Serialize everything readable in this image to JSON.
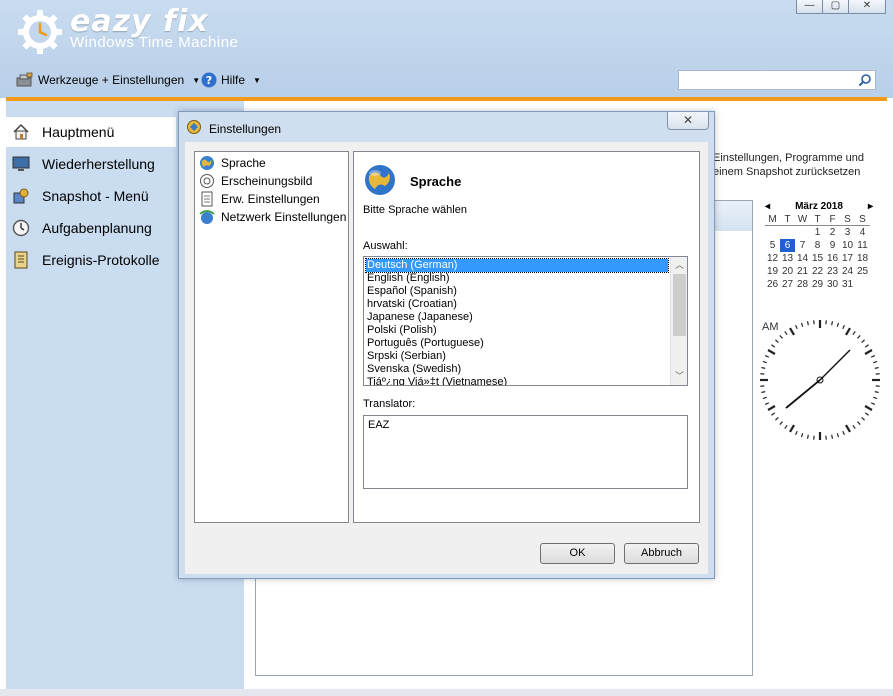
{
  "app": {
    "logo_title": "eazy fix",
    "logo_subtitle": "Windows Time Machine"
  },
  "window_controls": {
    "minimize": "—",
    "maximize": "▢",
    "close": "✕"
  },
  "menubar": {
    "tools_label": "Werkzeuge + Einstellungen",
    "help_label": "Hilfe"
  },
  "search": {
    "placeholder": ""
  },
  "sidebar": {
    "items": [
      {
        "label": "Hauptmenü",
        "icon": "home-icon",
        "active": true
      },
      {
        "label": "Wiederherstellung",
        "icon": "monitor-icon"
      },
      {
        "label": "Snapshot - Menü",
        "icon": "snapshot-icon"
      },
      {
        "label": "Aufgabenplanung",
        "icon": "clock-icon"
      },
      {
        "label": "Ereignis-Protokolle",
        "icon": "log-icon"
      }
    ]
  },
  "main": {
    "desc_line1": "Einstellungen, Programme und",
    "desc_line2": "einem Snapshot zurücksetzen"
  },
  "calendar": {
    "month_label": "März 2018",
    "prev": "◂",
    "next": "▸",
    "dow": [
      "M",
      "T",
      "W",
      "T",
      "F",
      "S",
      "S"
    ],
    "days": [
      "",
      "",
      "",
      "1",
      "2",
      "3",
      "4",
      "5",
      "6",
      "7",
      "8",
      "9",
      "10",
      "11",
      "12",
      "13",
      "14",
      "15",
      "16",
      "17",
      "18",
      "19",
      "20",
      "21",
      "22",
      "23",
      "24",
      "25",
      "26",
      "27",
      "28",
      "29",
      "30",
      "31",
      ""
    ],
    "today": "6"
  },
  "clock": {
    "ampm": "AM",
    "hour": 1.6,
    "minute": 7
  },
  "dialog": {
    "title": "Einstellungen",
    "close": "✕",
    "tree": [
      {
        "label": "Sprache",
        "icon": "globe-icon"
      },
      {
        "label": "Erscheinungsbild",
        "icon": "appearance-icon"
      },
      {
        "label": "Erw. Einstellungen",
        "icon": "document-icon"
      },
      {
        "label": "Netzwerk Einstellungen",
        "icon": "network-icon"
      }
    ],
    "heading": "Sprache",
    "subtitle": "Bitte Sprache wählen",
    "auswahl_label": "Auswahl:",
    "languages": [
      "Deutsch (German)",
      "English (English)",
      "Español (Spanish)",
      "hrvatski (Croatian)",
      "Japanese (Japanese)",
      "Polski (Polish)",
      "Português (Portuguese)",
      "Srpski (Serbian)",
      "Svenska (Swedish)",
      "Tiáº¿ng Viá»‡t (Vietnamese)"
    ],
    "selected_language": "Deutsch (German)",
    "translator_label": "Translator:",
    "translator_value": "EAZ",
    "ok_label": "OK",
    "cancel_label": "Abbruch"
  }
}
